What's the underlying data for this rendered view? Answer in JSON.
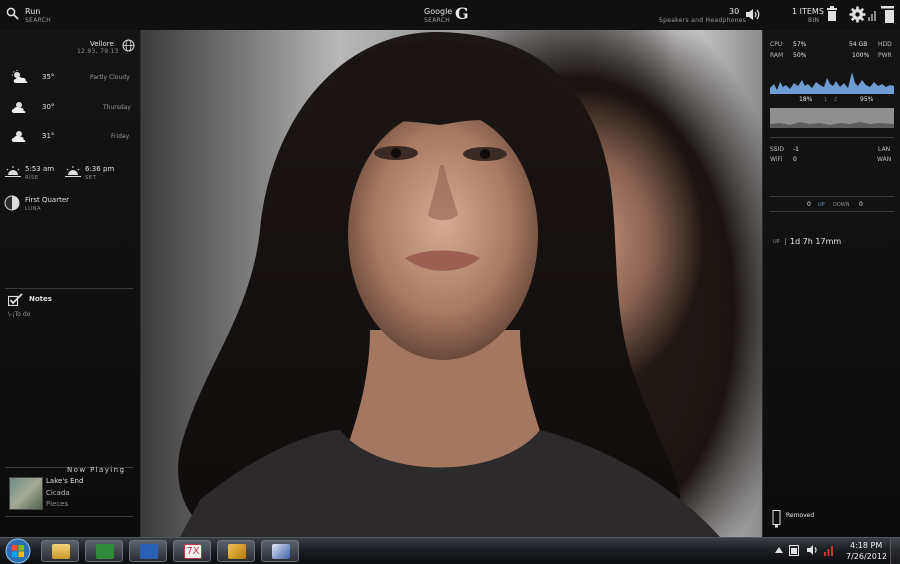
{
  "topbar": {
    "run_label": "Run",
    "run_sub": "SEARCH",
    "google_label": "Google",
    "google_sub": "SEARCH",
    "google_icon": "G",
    "volume_value": "30",
    "volume_sub": "Speakers and Headphones",
    "bin_label": "1 ITEMS",
    "bin_sub": "BIN"
  },
  "weather": {
    "city": "Vellore",
    "coords": "12.93, 79.13",
    "forecast": [
      {
        "temp": "35°",
        "desc": "Partly Cloudy"
      },
      {
        "temp": "30°",
        "desc": "Thursday"
      },
      {
        "temp": "31°",
        "desc": "Friday"
      }
    ],
    "sunrise": "5:53 am",
    "sunrise_sub": "RISE",
    "sunset": "6:36 pm",
    "sunset_sub": "SET",
    "moon": "First Quarter",
    "moon_sub": "LUNA"
  },
  "notes": {
    "title": "Notes",
    "body": "\\-¡To do"
  },
  "now_playing": {
    "heading": "Now Playing",
    "track": "Lake's End",
    "artist": "Cicada",
    "album": "Pieces"
  },
  "system": {
    "cpu_label": "CPU",
    "cpu_value": "57%",
    "ram_label": "RAM",
    "ram_value": "50%",
    "hdd_value": "54 GB",
    "hdd_label": "HDD",
    "pwr_value": "100%",
    "pwr_label": "PWR",
    "core1": "18%",
    "core_sep1": "1",
    "core_sep2": "2",
    "core2": "95%"
  },
  "network": {
    "ssid_label": "SSID",
    "ssid_value": "-1",
    "lan_label": "LAN",
    "wifi_label": "WiFi",
    "wifi_value": "0",
    "wan_label": "WAN",
    "up_value": "0",
    "up_label": "UP",
    "down_label": "DOWN",
    "down_value": "0"
  },
  "uptime": {
    "label": "UP",
    "value": "1d 7h 17mm"
  },
  "removed": {
    "label": "Removed"
  },
  "tray": {
    "time": "4:18 PM",
    "date": "7/26/2012"
  },
  "taskbar_apps": [
    {
      "name": "explorer",
      "color": "#d9b24c"
    },
    {
      "name": "excel",
      "color": "#2f8a3c"
    },
    {
      "name": "word",
      "color": "#2a5fb3"
    },
    {
      "name": "7x",
      "label": "7X",
      "color": "#c23a4a"
    },
    {
      "name": "app5",
      "color": "#d7a020"
    },
    {
      "name": "app6",
      "color": "#3a5fa8"
    }
  ]
}
